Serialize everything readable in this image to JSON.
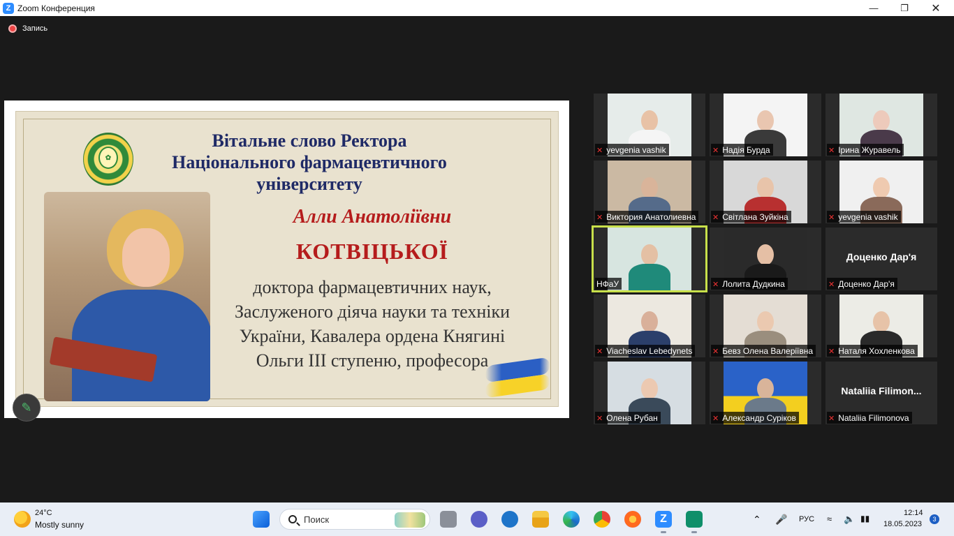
{
  "window": {
    "title": "Zoom Конференция",
    "app_icon": "zoom-icon"
  },
  "recording": {
    "label": "Запись"
  },
  "slide": {
    "heading_lines": [
      "Вітальне слово Ректора",
      "Національного фармацевтичного",
      "університету"
    ],
    "name_line1": "Алли Анатоліївни",
    "name_line2": "КОТВІЦЬКОЇ",
    "body_lines": [
      "доктора фармацевтичних наук,",
      "Заслуженого діяча науки та техніки",
      "України, Кавалера ордена Княгині",
      "Ольги III ступеню, професора"
    ],
    "seal_text": "SAPERE AUDE"
  },
  "participants": [
    {
      "name": "yevgenia vashik",
      "muted": true,
      "bg": "#e6ecea",
      "shirt": "#f5f5f5",
      "skin": "#e8c2a6"
    },
    {
      "name": "Надія Бурда",
      "muted": true,
      "bg": "#f4f4f4",
      "shirt": "#3a3a3a",
      "skin": "#e9c6b0"
    },
    {
      "name": "Ірина Журавель",
      "muted": true,
      "bg": "#dfe7e2",
      "shirt": "#4a3a4a",
      "skin": "#edcabb"
    },
    {
      "name": "Виктория Анатолиевна",
      "muted": true,
      "bg": "#cbb9a3",
      "shirt": "#556b8a",
      "skin": "#d9b49a"
    },
    {
      "name": "Світлана Зуйкіна",
      "muted": true,
      "bg": "#d8d8d8",
      "shirt": "#b83030",
      "skin": "#e8c4aa"
    },
    {
      "name": "yevgenia vashik",
      "muted": true,
      "bg": "#f0f0f0",
      "shirt": "#8a6a5a",
      "skin": "#efcab0"
    },
    {
      "name": "НФаУ",
      "muted": false,
      "active": true,
      "bg": "#d7e5e0",
      "shirt": "#1f8a7a",
      "skin": "#e4c0a4"
    },
    {
      "name": "Лолита Дудкина",
      "muted": true,
      "bg": "#2a2a2a",
      "shirt": "#1a1a1a",
      "skin": "#e5bfa5"
    },
    {
      "name": "Доценко Дар'я",
      "muted": true,
      "no_video": true
    },
    {
      "name": "Viacheslav Lebedynets",
      "muted": true,
      "bg": "#ece8e0",
      "shirt": "#2b3f6b",
      "skin": "#d9b09a"
    },
    {
      "name": "Бевз Олена Валеріївна",
      "muted": true,
      "bg": "#e4ddd4",
      "shirt": "#9a8e7e",
      "skin": "#ebc9b0"
    },
    {
      "name": "Наталя Хохленкова",
      "muted": true,
      "bg": "#ecece6",
      "shirt": "#2a2a2a",
      "skin": "#e7c3a8"
    },
    {
      "name": "Олена Рубан",
      "muted": true,
      "bg": "#d6dde2",
      "shirt": "#3a4a5a",
      "skin": "#ecc9b1"
    },
    {
      "name": "Александр Суріков",
      "muted": true,
      "bg": "#2a62c8",
      "shirt": "#6b7a8a",
      "skin": "#d9b49a",
      "flag": true
    },
    {
      "name": "Nataliia Filimonova",
      "muted": true,
      "no_video": true,
      "big_label": "Nataliia  Filimon..."
    }
  ],
  "taskbar": {
    "weather_temp": "24°C",
    "weather_desc": "Mostly sunny",
    "search_placeholder": "Поиск",
    "language": "РУС",
    "time": "12:14",
    "date": "18.05.2023",
    "notifications": "3"
  }
}
